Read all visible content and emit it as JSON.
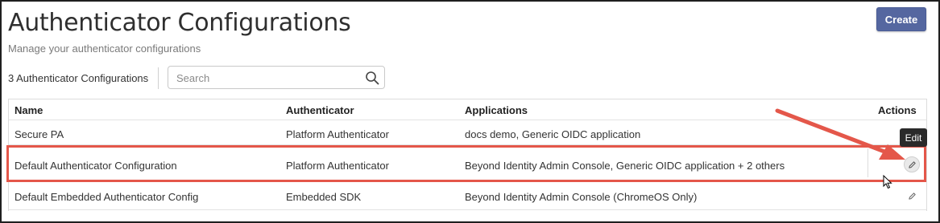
{
  "header": {
    "title": "Authenticator Configurations",
    "subtitle": "Manage your authenticator configurations",
    "create_label": "Create"
  },
  "toolbar": {
    "count_label": "3 Authenticator Configurations",
    "search_placeholder": "Search"
  },
  "table": {
    "columns": {
      "name": "Name",
      "authenticator": "Authenticator",
      "applications": "Applications",
      "actions": "Actions"
    },
    "rows": [
      {
        "name": "Secure PA",
        "authenticator": "Platform Authenticator",
        "applications": "docs demo, Generic OIDC application"
      },
      {
        "name": "Default Authenticator Configuration",
        "authenticator": "Platform Authenticator",
        "applications": "Beyond Identity Admin Console, Generic OIDC application + 2 others"
      },
      {
        "name": "Default Embedded Authenticator Config",
        "authenticator": "Embedded SDK",
        "applications": "Beyond Identity Admin Console (ChromeOS Only)"
      }
    ]
  },
  "tooltip": {
    "edit": "Edit"
  },
  "icons": {
    "search": "search-icon",
    "edit": "pencil-icon",
    "cursor": "mouse-pointer-icon",
    "annotation": "annotation-arrow"
  },
  "colors": {
    "create_button": "#5567a0",
    "highlight": "#e4574a",
    "tooltip": "#2a2a2a"
  }
}
